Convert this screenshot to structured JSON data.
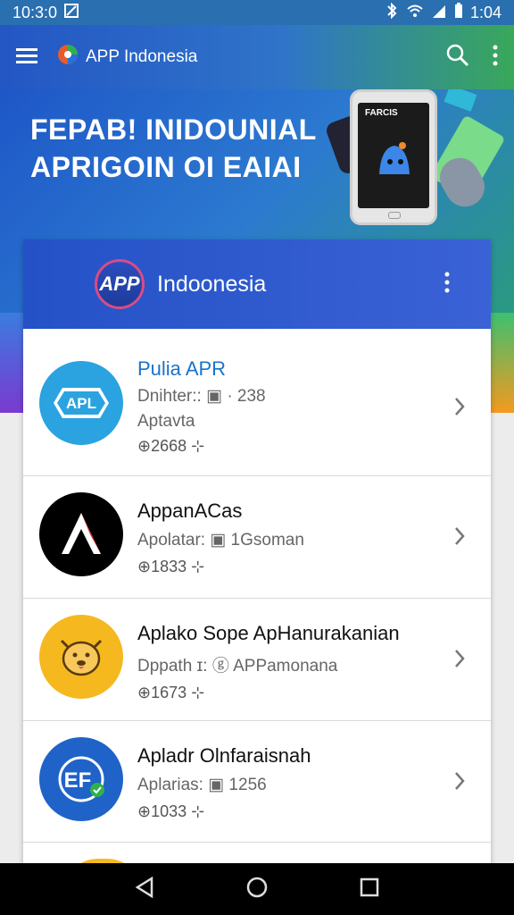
{
  "status_bar": {
    "time": "10:3:0",
    "right_time": "1:04",
    "icons": [
      "sim-icon",
      "bluetooth-icon",
      "wifi-icon",
      "signal-icon",
      "battery-icon"
    ]
  },
  "app_bar": {
    "title": "APP Indonesia",
    "menu_icon": "hamburger-icon",
    "search_icon": "search-icon",
    "overflow_icon": "more-vert-icon"
  },
  "hero": {
    "title_line1": "FEPAB! INIDOUNIAL",
    "title_line2": "APRIGOIN OI EAIAI",
    "phone_text": "FARCIS"
  },
  "card": {
    "logo_text": "APP",
    "title": "Indoonesia",
    "overflow_icon": "more-vert-icon"
  },
  "apps": [
    {
      "name": "Pulia APR",
      "sub1": "Dnihter:: ▣ · 238",
      "sub2": "Aptavta",
      "meta": "⊕2668 ⊹",
      "icon_text": "APL",
      "icon_color": "#2aa3e0",
      "name_color": "#1a73c9"
    },
    {
      "name": "AppanACas",
      "sub1": "Apolatar: ▣ 1Gsoman",
      "sub2": "",
      "meta": "⊕1833 ⊹",
      "icon_text": "",
      "icon_color": "#000000",
      "name_color": "#111111"
    },
    {
      "name": "Aplako Sope ApHanurakanian",
      "sub1": "Dppath ɪ: ⓖ APPamonana",
      "sub2": "",
      "meta": "⊕1673 ⊹",
      "icon_text": "",
      "icon_color": "#f5b81f",
      "name_color": "#111111"
    },
    {
      "name": "Apladr Olnfaraisnah",
      "sub1": "Aplarias: ▣ 1256",
      "sub2": "",
      "meta": "⊕1033 ⊹",
      "icon_text": "EF",
      "icon_color": "#1f63c8",
      "name_color": "#111111"
    }
  ],
  "colors": {
    "appbar_start": "#2456c4",
    "appbar_end": "#39a85a",
    "card_header": "#2452c6"
  },
  "nav": {
    "back_icon": "back-triangle-icon",
    "home_icon": "home-circle-icon",
    "recents_icon": "recents-square-icon"
  }
}
